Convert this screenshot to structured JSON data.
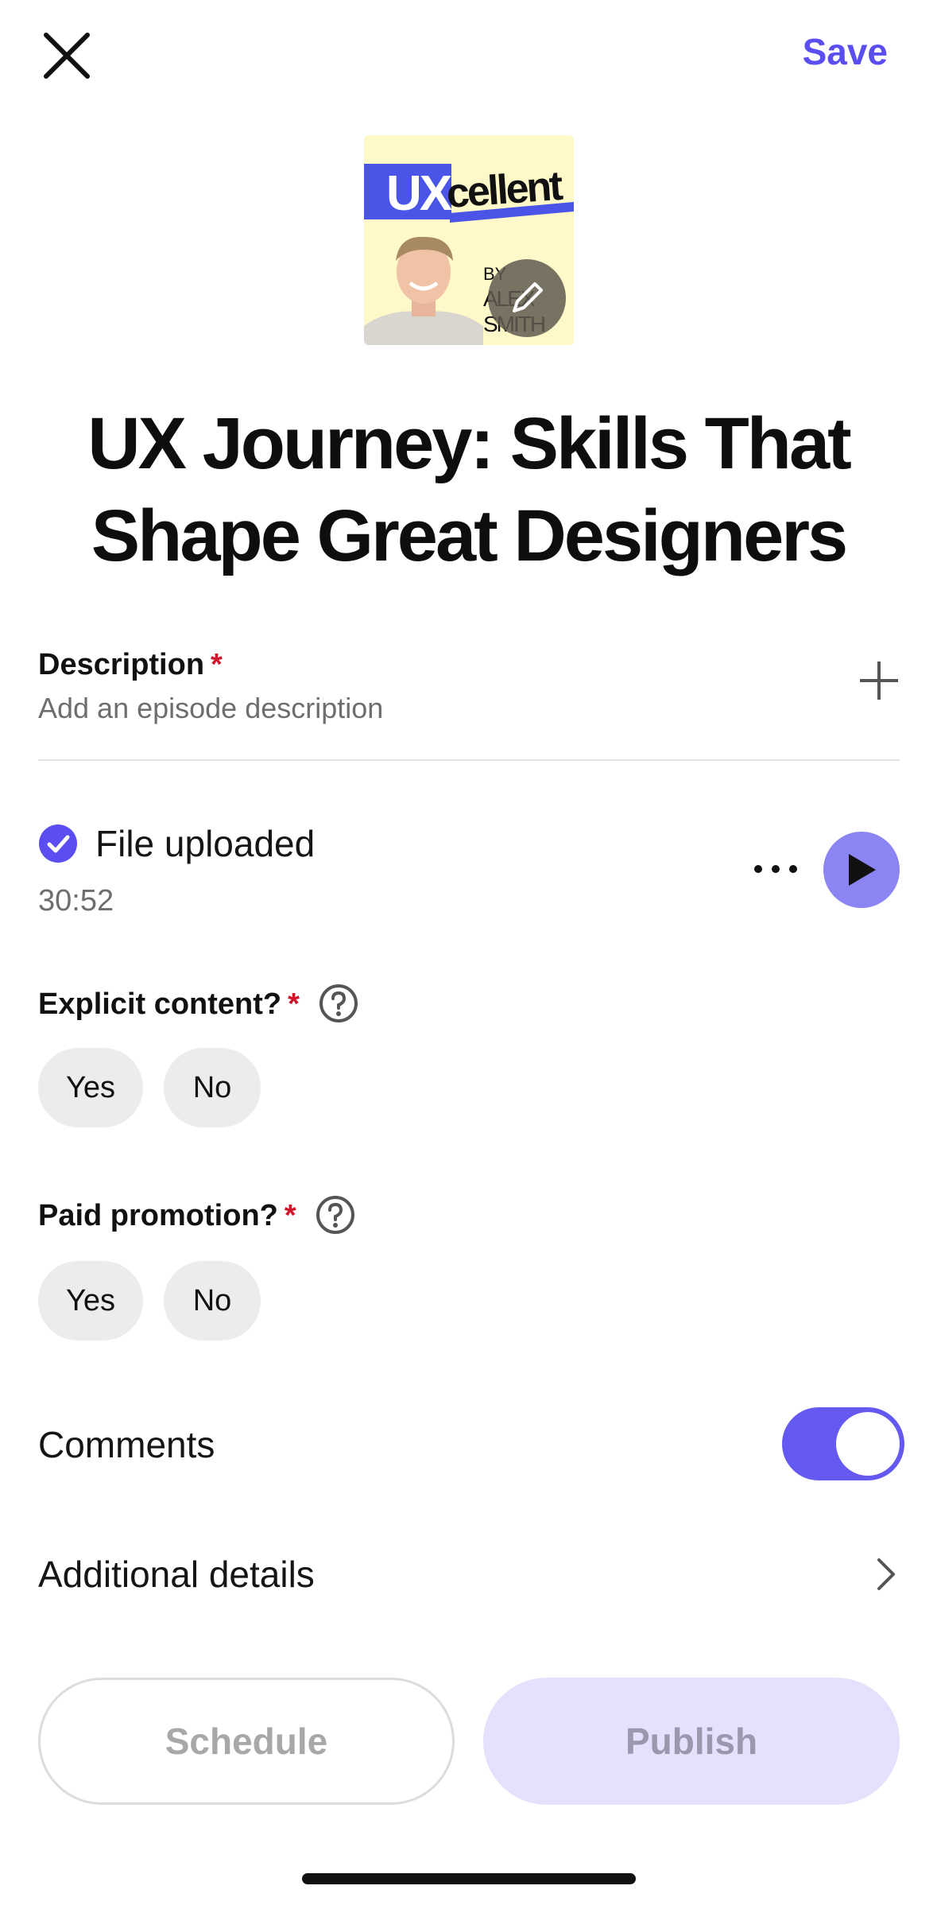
{
  "header": {
    "close_icon": "close-icon",
    "save_label": "Save",
    "accent_color": "#5a4ef0"
  },
  "cover": {
    "brand_prefix": "UX",
    "brand_suffix": "cellent",
    "by_label": "BY",
    "author": "ALEX SMITH",
    "edit_icon": "pencil-icon"
  },
  "episode": {
    "title": "UX Journey: Skills That Shape Great Designers"
  },
  "description": {
    "label": "Description",
    "required_mark": "*",
    "placeholder": "Add an episode description",
    "add_icon": "plus-icon"
  },
  "file": {
    "status": "File uploaded",
    "duration": "30:52",
    "more_icon": "more-icon",
    "play_icon": "play-icon"
  },
  "explicit": {
    "label": "Explicit content?",
    "required_mark": "*",
    "help_icon": "help-icon",
    "options": [
      "Yes",
      "No"
    ]
  },
  "paid_promotion": {
    "label": "Paid promotion?",
    "required_mark": "*",
    "help_icon": "help-icon",
    "options": [
      "Yes",
      "No"
    ]
  },
  "comments": {
    "label": "Comments",
    "enabled": true
  },
  "additional_details": {
    "label": "Additional details"
  },
  "actions": {
    "schedule_label": "Schedule",
    "publish_label": "Publish"
  }
}
